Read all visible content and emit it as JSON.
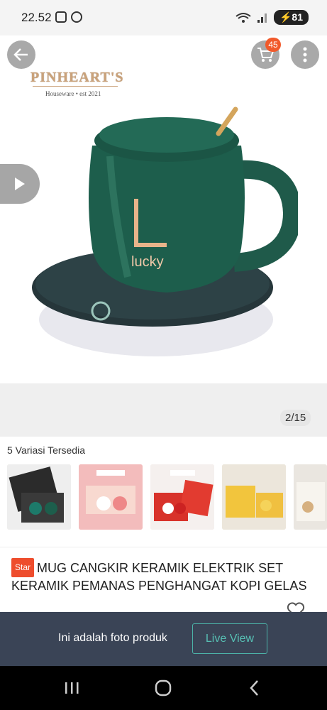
{
  "status_bar": {
    "time": "22.52",
    "battery": "81"
  },
  "header": {
    "cart_count": "45"
  },
  "brand": {
    "name": "PINHEART'S",
    "tagline": "Houseware • est 2021"
  },
  "gallery": {
    "counter": "2/15",
    "mug_text": "lucky"
  },
  "variants": {
    "title": "5 Variasi Tersedia",
    "items": [
      {
        "label": "variant-1"
      },
      {
        "label": "variant-2"
      },
      {
        "label": "variant-3"
      },
      {
        "label": "variant-4"
      },
      {
        "label": "variant-5"
      }
    ]
  },
  "product": {
    "badge": "Star",
    "title": "MUG CANGKIR KERAMIK ELEKTRIK SET KERAMIK PEMANAS PENGHANGAT KOPI GELAS"
  },
  "notice": {
    "text": "Ini adalah foto produk",
    "button": "Live View"
  },
  "colors": {
    "accent": "#ee4d2d",
    "notice_bg": "#3a4456",
    "live_view": "#4cb3a8"
  }
}
